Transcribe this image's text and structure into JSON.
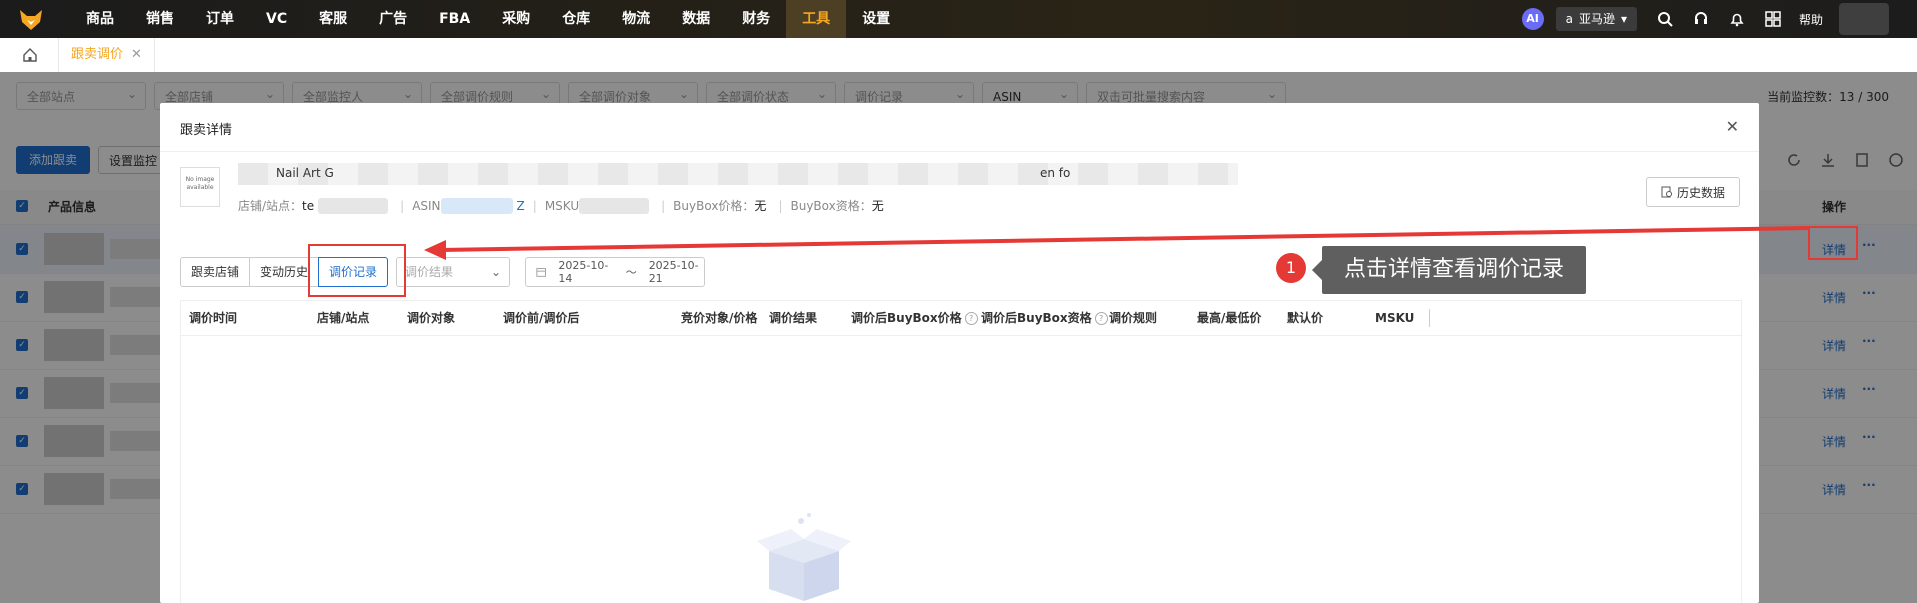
{
  "topnav": {
    "items": [
      "商品",
      "销售",
      "订单",
      "VC",
      "客服",
      "广告",
      "FBA",
      "采购",
      "仓库",
      "物流",
      "数据",
      "财务",
      "工具",
      "设置"
    ],
    "active": "工具",
    "ai_label": "AI",
    "platform": "亚马逊",
    "help": "帮助"
  },
  "tabbar": {
    "page_tab": "跟卖调价",
    "close": "✕"
  },
  "background": {
    "filters": [
      "全部站点",
      "全部店铺",
      "全部监控人",
      "全部调价规则",
      "全部调价对象",
      "全部调价状态",
      "调价记录",
      "ASIN"
    ],
    "search_placeholder": "双击可批量搜索内容",
    "monitor_count": "当前监控数：13 / 300",
    "add_button": "添加跟卖",
    "set_button": "设置监控",
    "col_product": "产品信息",
    "col_action": "操作",
    "row_detail": "详情",
    "row_more": "···"
  },
  "modal": {
    "title": "跟卖详情",
    "product_title_start": "Nail Art G",
    "product_title_end": "en fo",
    "no_image": "No image available",
    "store_label": "店铺/站点：",
    "store_value": "te",
    "asin_label": "ASIN",
    "asin_suffix": "Z",
    "msku_label": "MSKU",
    "buybox_price_label": "BuyBox价格：",
    "buybox_price_value": "无",
    "buybox_qual_label": "BuyBox资格：",
    "buybox_qual_value": "无",
    "history_button": "历史数据",
    "subtabs": [
      "跟卖店铺",
      "变动历史",
      "调价记录"
    ],
    "active_subtab": "调价记录",
    "result_placeholder": "调价结果",
    "date_start": "2025-10-14",
    "date_sep": "～",
    "date_end": "2025-10-21",
    "columns": [
      "调价时间",
      "店铺/站点",
      "调价对象",
      "调价前/调价后",
      "竞价对象/价格",
      "调价结果",
      "调价后BuyBox价格",
      "调价后BuyBox资格",
      "调价规则",
      "最高/最低价",
      "默认价",
      "MSKU"
    ]
  },
  "annotation": {
    "step": "1",
    "text": "点击详情查看调价记录",
    "color": "#e53935"
  }
}
